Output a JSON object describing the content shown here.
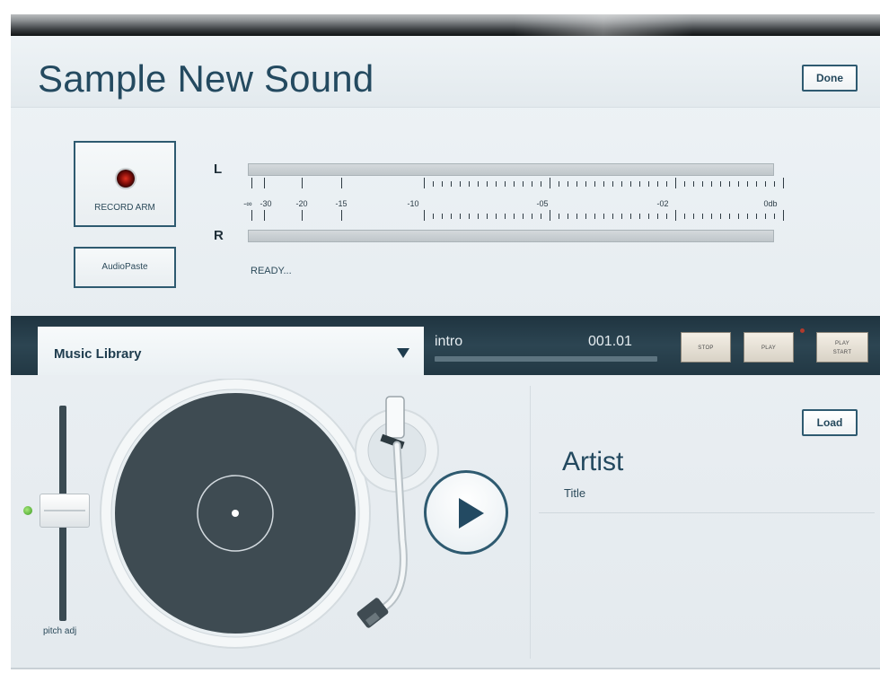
{
  "header": {
    "title": "Sample New Sound",
    "done_label": "Done"
  },
  "recorder": {
    "record_arm_label": "RECORD ARM",
    "audiopaste_label": "AudioPaste",
    "channel_left": "L",
    "channel_right": "R",
    "scale_labels": [
      "-∞",
      "-30",
      "-20",
      "-15",
      "-10",
      "-05",
      "-02",
      "0db"
    ],
    "status": "READY..."
  },
  "transport": {
    "library_label": "Music Library",
    "track_name": "intro",
    "track_position": "001.01",
    "progress_fraction": 0.0,
    "stop_label": "STOP",
    "play_label": "PLAY",
    "play_start_line1": "PLAY",
    "play_start_line2": "START"
  },
  "deck": {
    "pitch_label": "pitch adj",
    "load_label": "Load",
    "artist": "Artist",
    "title": "Title"
  },
  "colors": {
    "accent": "#2e5a70",
    "transport_bg": "#2c4552",
    "platter": "#3d4b52"
  }
}
